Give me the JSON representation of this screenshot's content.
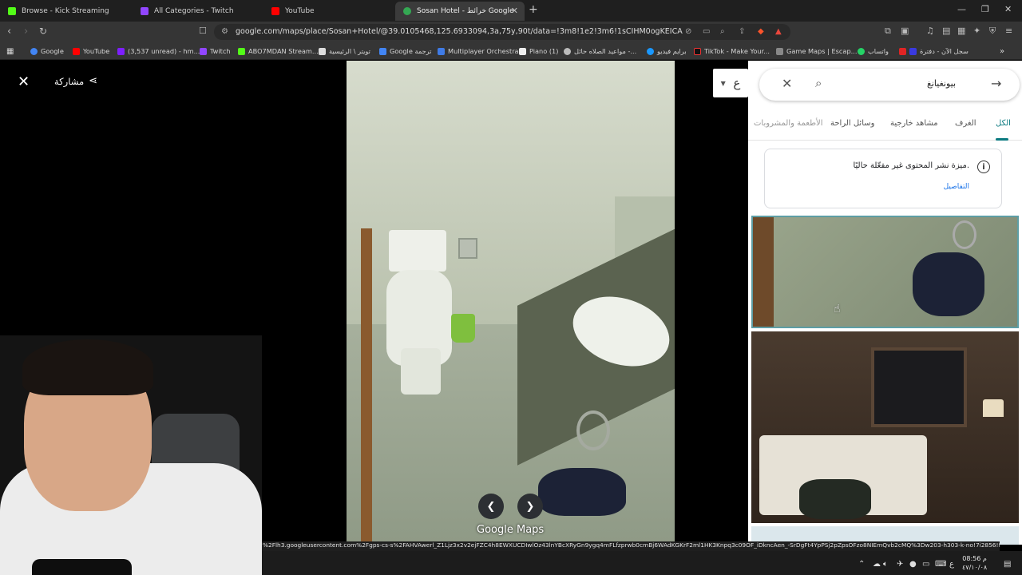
{
  "browser": {
    "tabs": [
      {
        "title": "Browse - Kick Streaming",
        "color": "#53fc18"
      },
      {
        "title": "All Categories - Twitch",
        "color": "#9146ff"
      },
      {
        "title": "YouTube",
        "color": "#ff0000"
      },
      {
        "title": "Sosan Hotel - خرائط Google",
        "color": "#34a853",
        "active": true
      }
    ],
    "url": "google.com/maps/place/Sosan+Hotel/@39.0105468,125.6933094,3a,75y,90t/data=!3m8!1e2!3m6!1sCIHM0ogKEICAgIDE1KOnOQ!2e...",
    "bookmarks": [
      "Google",
      "YouTube",
      "(3,537 unread) - hm...",
      "Twitch",
      "ABO7MDAN Stream...",
      "تويتر \\ الرئيسية",
      "Google ترجمة",
      "Multiplayer Orchestra",
      "Piano (1)",
      "مواعيد الصلاه حائل -...",
      "برايم فيديو",
      "TikTok - Make Your...",
      "Game Maps | Escap...",
      "واتساب",
      "سجل الآن - دفترة"
    ]
  },
  "viewer": {
    "share_label": "مشاركة",
    "brand_label": "Google Maps",
    "language_button": "ع"
  },
  "panel": {
    "search_query": "بيونغيانغ",
    "tabs": [
      "الكل",
      "الغرف",
      "مشاهد خارجية",
      "وسائل الراحة",
      "الأطعمة والمشروبات"
    ],
    "notice": {
      "message": "ميزة نشر المحتوى غير مفعّلة حاليًا.",
      "details_link": "التفاصيل"
    }
  },
  "status_url": "%2Flh3.googleusercontent.com%2Fgps-cs-s%2FAHVAwerl_Z1Ljz3x2v2ejFZC4h8EWXUCDIwlOz43lnYBcXRyGn9ygq4mFLfzprwb0cmBj6WAdKGKrF2ml1HK3Knpq3c09OF_iDkncAen_-SrDgFt4YpPSj2pZpsOFzo8NIEmQvb2cMQ%3Dw203-h303-k-no!7i2856!8i4272!4m...",
  "taskbar": {
    "time": "08:56 م",
    "date": "٤٧/١٠/٠٨"
  },
  "colors": {
    "accent_teal": "#0b7a80",
    "link_blue": "#1a73e8"
  }
}
